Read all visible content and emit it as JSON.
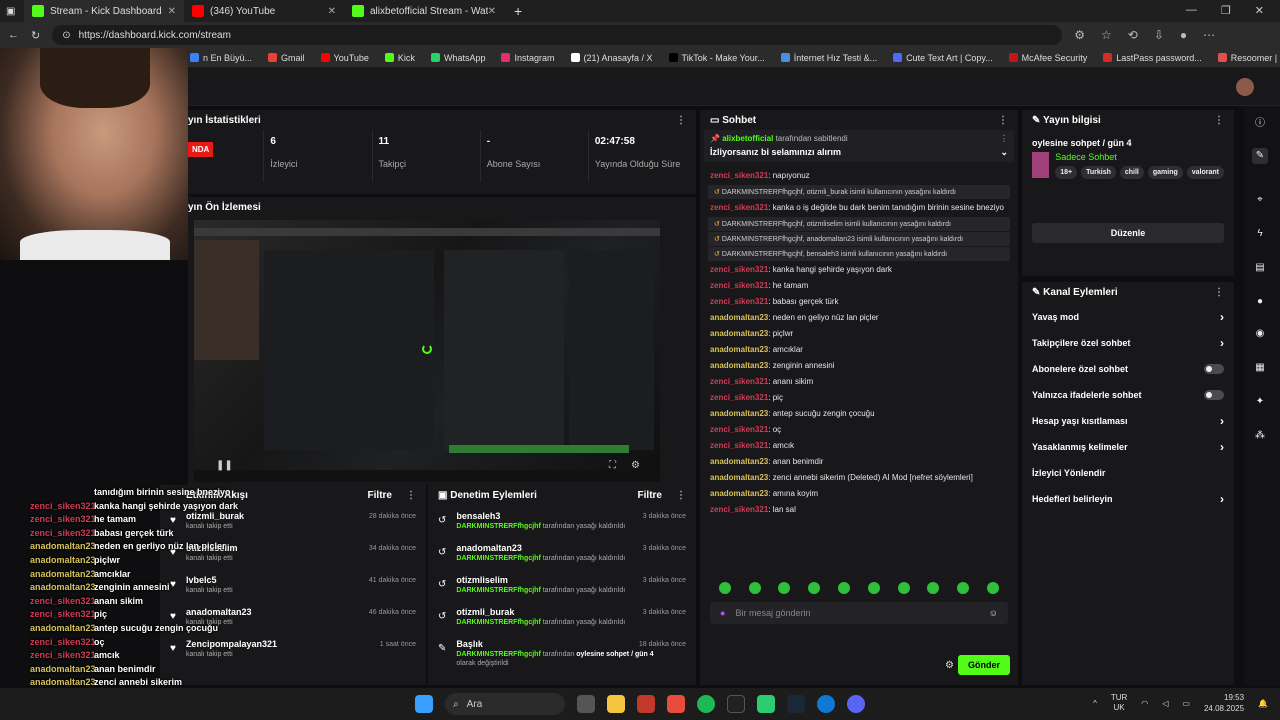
{
  "browser": {
    "tabs": [
      {
        "label": "Stream - Kick Dashboard",
        "color": "#53fc18"
      },
      {
        "label": "(346) YouTube",
        "color": "#ff0000"
      },
      {
        "label": "alixbetofficial Stream - Watch Live",
        "color": "#53fc18"
      }
    ],
    "url": "https://dashboard.kick.com/stream",
    "bookmarks": [
      {
        "label": "n En Büyü...",
        "color": "#3b82f6"
      },
      {
        "label": "Gmail",
        "color": "#ea4335"
      },
      {
        "label": "YouTube",
        "color": "#ff0000"
      },
      {
        "label": "Kick",
        "color": "#53fc18"
      },
      {
        "label": "WhatsApp",
        "color": "#25d366"
      },
      {
        "label": "Instagram",
        "color": "#e1306c"
      },
      {
        "label": "(21) Anasayfa / X",
        "color": "#ffffff"
      },
      {
        "label": "TikTok - Make Your...",
        "color": "#000000"
      },
      {
        "label": "İnternet Hız Testi &...",
        "color": "#4a90e2"
      },
      {
        "label": "Cute Text Art | Copy...",
        "color": "#4a6cf7"
      },
      {
        "label": "McAfee Security",
        "color": "#c01818"
      },
      {
        "label": "LastPass password...",
        "color": "#d32d27"
      },
      {
        "label": "Resoomer | Çevrimi...",
        "color": "#e05050"
      }
    ]
  },
  "stats": {
    "title": "yın İstatistikleri",
    "live_label": "NDA",
    "items": [
      {
        "value": "6",
        "label": "İzleyici"
      },
      {
        "value": "11",
        "label": "Takipçi"
      },
      {
        "value": "-",
        "label": "Abone Sayısı"
      },
      {
        "value": "02:47:58",
        "label": "Yayında Olduğu Süre"
      }
    ]
  },
  "preview": {
    "title": "yın Ön İzlemesi"
  },
  "activity": {
    "title": "Etkinlik Akışı",
    "filter": "Filtre",
    "items": [
      {
        "name": "otizmli_burak",
        "sub": "kanalı takip etti",
        "time": "28 dakika önce"
      },
      {
        "name": "otizmliselim",
        "sub": "kanalı takip etti",
        "time": "34 dakika önce"
      },
      {
        "name": "lvbelc5",
        "sub": "kanalı takip etti",
        "time": "41 dakika önce"
      },
      {
        "name": "anadomaltan23",
        "sub": "kanalı takip etti",
        "time": "46 dakika önce"
      },
      {
        "name": "Zencipompalayan321",
        "sub": "kanalı takip etti",
        "time": "1 saat önce"
      }
    ]
  },
  "moderation": {
    "title": "Denetim Eylemleri",
    "filter": "Filtre",
    "items": [
      {
        "name": "bensaleh3",
        "by": "DARKMINSTRERFfhgcjhf",
        "text": "tarafından yasağı kaldırıldı",
        "time": "3 dakika önce"
      },
      {
        "name": "anadomaltan23",
        "by": "DARKMINSTRERFfhgcjhf",
        "text": "tarafından yasağı kaldırıldı",
        "time": "3 dakika önce"
      },
      {
        "name": "otizmliselim",
        "by": "DARKMINSTRERFfhgcjhf",
        "text": "tarafından yasağı kaldırıldı",
        "time": "3 dakika önce"
      },
      {
        "name": "otizmli_burak",
        "by": "DARKMINSTRERFfhgcjhf",
        "text": "tarafından yasağı kaldırıldı",
        "time": "3 dakika önce"
      }
    ],
    "title_change": {
      "name": "Başlık",
      "by": "DARKMINSTRERFfhgcjhf",
      "text": "tarafından",
      "bold": "oylesine sohpet / gün 4",
      "line2": "olarak değiştirildi",
      "time": "18 dakika önce"
    }
  },
  "overlay": [
    {
      "user": "",
      "msg": "tanıdığım birinin sesine bneziyo",
      "c": "u-yel"
    },
    {
      "user": "zenci_siken321",
      "msg": "kanka hangi şehirde yaşıyon dark",
      "c": "u-red"
    },
    {
      "user": "zenci_siken321",
      "msg": "he tamam",
      "c": "u-red"
    },
    {
      "user": "zenci_siken321",
      "msg": "babası gerçek türk",
      "c": "u-red"
    },
    {
      "user": "anadomaltan23",
      "msg": "neden en gerliyo nüz lan piçler",
      "c": "u-yel"
    },
    {
      "user": "anadomaltan23",
      "msg": "piçlwr",
      "c": "u-yel"
    },
    {
      "user": "anadomaltan23",
      "msg": "amcıklar",
      "c": "u-yel"
    },
    {
      "user": "anadomaltan23",
      "msg": "zenginin annesini",
      "c": "u-yel"
    },
    {
      "user": "zenci_siken321",
      "msg": "ananı sikim",
      "c": "u-red"
    },
    {
      "user": "zenci_siken321",
      "msg": "piç",
      "c": "u-red"
    },
    {
      "user": "anadomaltan23",
      "msg": "antep sucuğu zengin çocuğu",
      "c": "u-yel"
    },
    {
      "user": "zenci_siken321",
      "msg": "oç",
      "c": "u-red"
    },
    {
      "user": "zenci_siken321",
      "msg": "amcık",
      "c": "u-red"
    },
    {
      "user": "anadomaltan23",
      "msg": "anan benimdir",
      "c": "u-yel"
    },
    {
      "user": "anadomaltan23",
      "msg": "zenci annebi sikerim",
      "c": "u-yel"
    },
    {
      "user": "anadomaltan23",
      "msg": "amına koyim",
      "c": "u-yel"
    },
    {
      "user": "zenci_siken321",
      "msg": "lan sal",
      "c": "u-red"
    }
  ],
  "chat": {
    "title": "Sohbet",
    "pinned_by": "alixbetofficial",
    "pinned_by_text": "tarafından sabitlendi",
    "pinned_msg": "İzliyorsanız bi selamınızı alırım",
    "lines": [
      {
        "type": "msg",
        "user": "zenci_siken321",
        "c": "u-red",
        "msg": "napıyonuz"
      },
      {
        "type": "sys",
        "msg": "DARKMINSTRERFfhgcjhf, otizmli_burak isimli kullanıcının yasağını kaldırdı"
      },
      {
        "type": "msg",
        "user": "zenci_siken321",
        "c": "u-red",
        "msg": "kanka o iş değilde bu dark benim tanıdığım birinin sesine bneziyo"
      },
      {
        "type": "sys",
        "msg": "DARKMINSTRERFfhgcjhf, otizmliselim isimli kullanıcının yasağını kaldırdı"
      },
      {
        "type": "sys",
        "msg": "DARKMINSTRERFfhgcjhf, anadomaltan23 isimli kullanıcının yasağını kaldırdı"
      },
      {
        "type": "sys",
        "msg": "DARKMINSTRERFfhgcjhf, bensaleh3 isimli kullanıcının yasağını kaldırdı"
      },
      {
        "type": "msg",
        "user": "zenci_siken321",
        "c": "u-red",
        "msg": "kanka hangi şehirde yaşıyon dark"
      },
      {
        "type": "msg",
        "user": "zenci_siken321",
        "c": "u-red",
        "msg": "he tamam"
      },
      {
        "type": "msg",
        "user": "zenci_siken321",
        "c": "u-red",
        "msg": "babası gerçek türk"
      },
      {
        "type": "msg",
        "user": "anadomaltan23",
        "c": "u-yel",
        "msg": "neden en geliyo nüz lan piçler"
      },
      {
        "type": "msg",
        "user": "anadomaltan23",
        "c": "u-yel",
        "msg": "piçlwr"
      },
      {
        "type": "msg",
        "user": "anadomaltan23",
        "c": "u-yel",
        "msg": "amcıklar"
      },
      {
        "type": "msg",
        "user": "anadomaltan23",
        "c": "u-yel",
        "msg": "zenginin annesini"
      },
      {
        "type": "msg",
        "user": "zenci_siken321",
        "c": "u-red",
        "msg": "ananı sikim"
      },
      {
        "type": "msg",
        "user": "zenci_siken321",
        "c": "u-red",
        "msg": "piç"
      },
      {
        "type": "msg",
        "user": "anadomaltan23",
        "c": "u-yel",
        "msg": "antep sucuğu zengin çocuğu"
      },
      {
        "type": "msg",
        "user": "zenci_siken321",
        "c": "u-red",
        "msg": "oç"
      },
      {
        "type": "msg",
        "user": "zenci_siken321",
        "c": "u-red",
        "msg": "amcık"
      },
      {
        "type": "msg",
        "user": "anadomaltan23",
        "c": "u-yel",
        "msg": "anan benimdir"
      },
      {
        "type": "msg",
        "user": "anadomaltan23",
        "c": "u-yel",
        "msg": "zenci annebi sikerim (Deleted) AI Mod [nefret söylemleri]"
      },
      {
        "type": "msg",
        "user": "anadomaltan23",
        "c": "u-yel",
        "msg": "amına koyim"
      },
      {
        "type": "msg",
        "user": "zenci_siken321",
        "c": "u-red",
        "msg": "lan sal"
      }
    ],
    "input_placeholder": "Bir mesaj gönderin",
    "send_label": "Gönder"
  },
  "stream_info": {
    "title": "Yayın bilgisi",
    "stream_title": "oylesine sohpet / gün 4",
    "category": "Sadece Sohbet",
    "tags": [
      "18+",
      "Turkish",
      "chill",
      "gaming",
      "valorant"
    ],
    "edit_label": "Düzenle"
  },
  "channel_actions": {
    "title": "Kanal Eylemleri",
    "items": [
      {
        "label": "Yavaş mod",
        "kind": "arrow"
      },
      {
        "label": "Takipçilere özel sohbet",
        "kind": "arrow"
      },
      {
        "label": "Abonelere özel sohbet",
        "kind": "toggle"
      },
      {
        "label": "Yalnızca ifadelerle sohbet",
        "kind": "toggle"
      },
      {
        "label": "Hesap yaşı kısıtlaması",
        "kind": "arrow"
      },
      {
        "label": "Yasaklanmış kelimeler",
        "kind": "arrow"
      },
      {
        "label": "İzleyici Yönlendir",
        "kind": "none"
      },
      {
        "label": "Hedefleri belirleyin",
        "kind": "arrow"
      }
    ]
  },
  "taskbar": {
    "search": "Ara",
    "lang": "TUR",
    "lang2": "UK",
    "time": "19:53",
    "date": "24.08.2025"
  }
}
